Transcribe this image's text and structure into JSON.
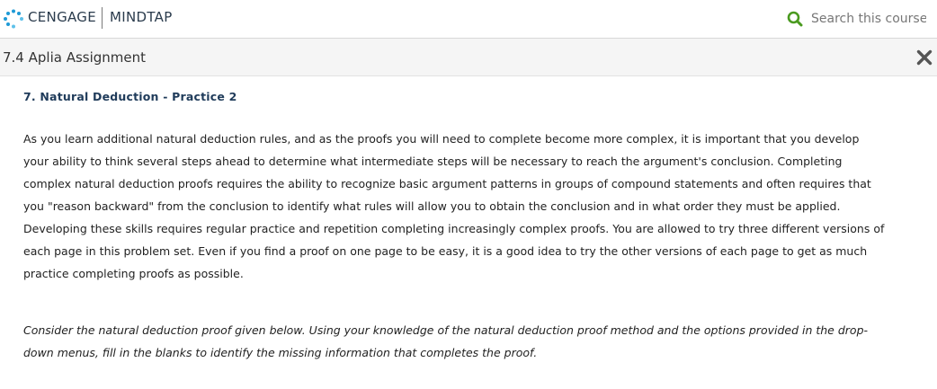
{
  "header": {
    "brand": "CENGAGE",
    "product": "MINDTAP",
    "search_placeholder": "Search this course"
  },
  "assignment": {
    "title": "7.4 Aplia Assignment",
    "close_label": "Close"
  },
  "question": {
    "title": "7. Natural Deduction - Practice 2",
    "intro": "As you learn additional natural deduction rules, and as the proofs you will need to complete become more complex, it is important that you develop your ability to think several steps ahead to determine what intermediate steps will be necessary to reach the argument's conclusion. Completing complex natural deduction proofs requires the ability to recognize basic argument patterns in groups of compound statements and often requires that you \"reason backward\" from the conclusion to identify what rules will allow you to obtain the conclusion and in what order they must be applied. Developing these skills requires regular practice and repetition completing increasingly complex proofs. You are allowed to try three different versions of each page in this problem set. Even if you find a proof on one page to be easy, it is a good idea to try the other versions of each page to get as much practice completing proofs as possible.",
    "instructions": "Consider the natural deduction proof given below. Using your knowledge of the natural deduction proof method and the options provided in the drop-down menus, fill in the blanks to identify the missing information that completes the proof."
  },
  "colors": {
    "brand_blue": "#1e9ad6",
    "search_green": "#4a9a1f",
    "title_navy": "#1f3b5a"
  }
}
